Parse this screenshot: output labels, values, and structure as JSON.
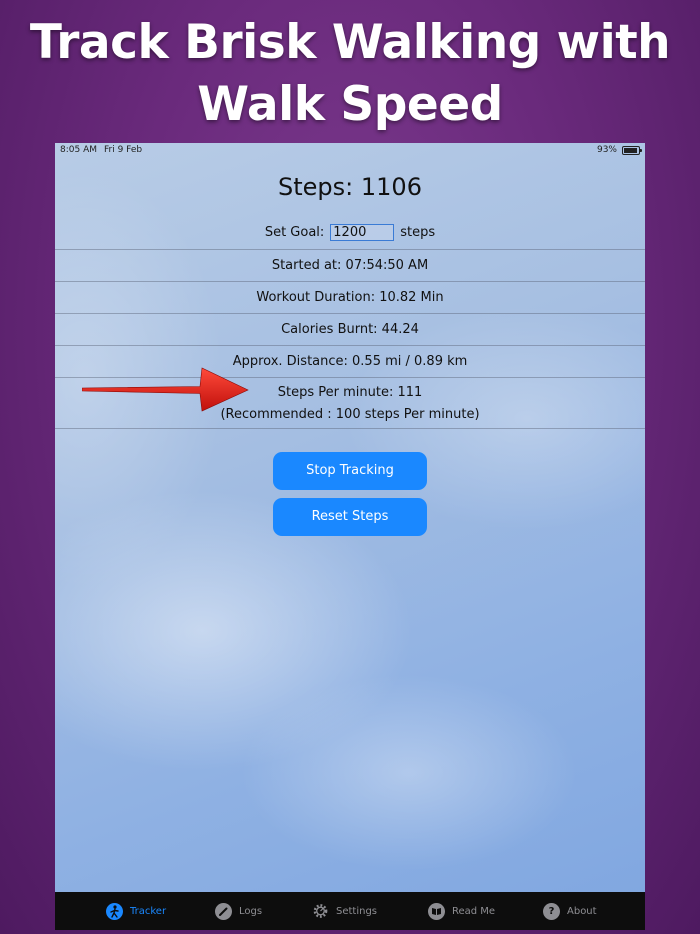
{
  "banner": {
    "line1": "Track Brisk Walking with",
    "line2": "Walk Speed"
  },
  "status_bar": {
    "time": "8:05 AM",
    "date": "Fri 9 Feb",
    "battery": "93%",
    "battery_level": 0.93
  },
  "tracker": {
    "steps_title": "Steps: 1106",
    "goal_label": "Set Goal:",
    "goal_value": "1200",
    "goal_unit": "steps",
    "started_at": "Started at: 07:54:50 AM",
    "duration": "Workout Duration: 10.82 Min",
    "calories": "Calories Burnt: 44.24",
    "distance": "Approx. Distance: 0.55 mi / 0.89 km",
    "spm": "Steps Per minute: 111",
    "recommended": "(Recommended : 100 steps Per minute)"
  },
  "buttons": {
    "stop": "Stop Tracking",
    "reset": "Reset Steps"
  },
  "tabs": [
    {
      "label": "Tracker",
      "icon": "walking-person-icon",
      "active": true
    },
    {
      "label": "Logs",
      "icon": "pencil-icon",
      "active": false
    },
    {
      "label": "Settings",
      "icon": "gear-icon",
      "active": false
    },
    {
      "label": "Read Me",
      "icon": "book-icon",
      "active": false
    },
    {
      "label": "About",
      "icon": "question-icon",
      "active": false
    }
  ],
  "colors": {
    "accent": "#1a88ff",
    "tab_inactive": "#8e8e93",
    "arrow": "#e0201c"
  }
}
